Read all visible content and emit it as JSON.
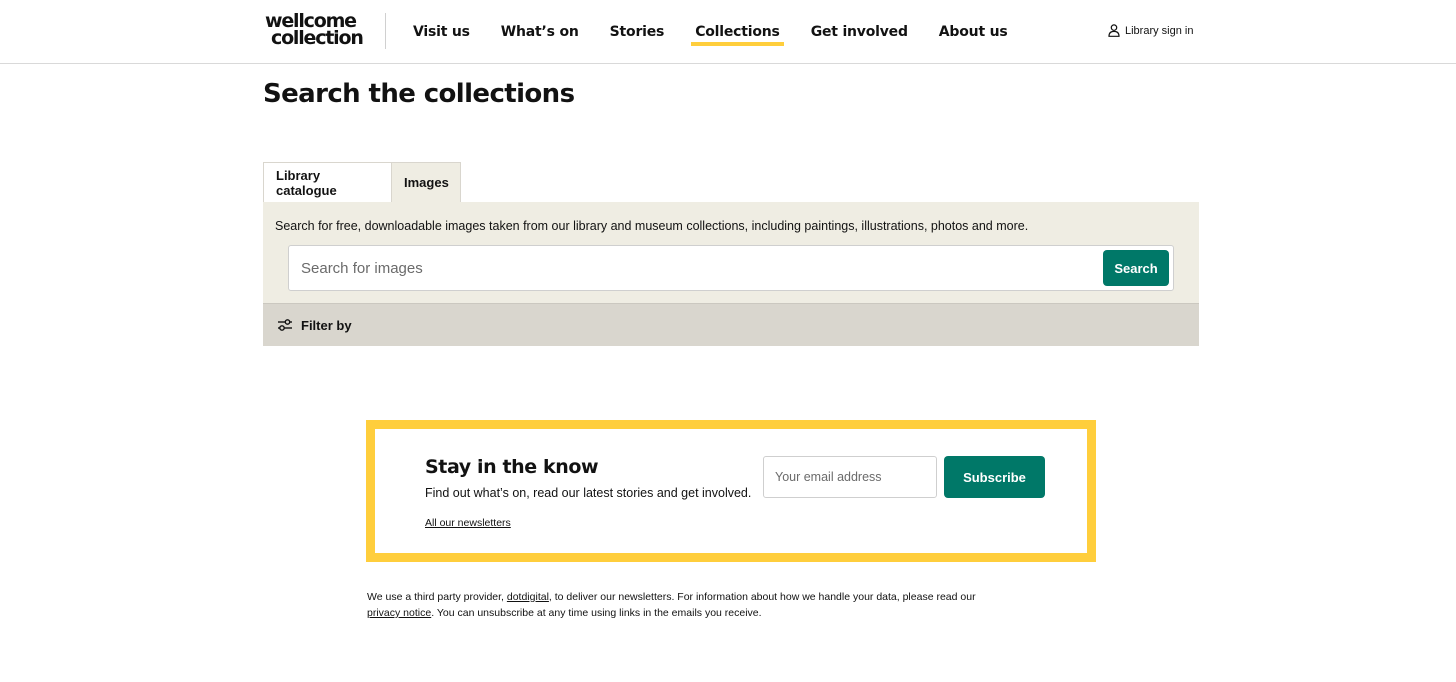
{
  "header": {
    "logo": {
      "line1": "wellcome",
      "line2": "collection"
    },
    "nav": [
      {
        "label": "Visit us",
        "active": false
      },
      {
        "label": "What’s on",
        "active": false
      },
      {
        "label": "Stories",
        "active": false
      },
      {
        "label": "Collections",
        "active": true
      },
      {
        "label": "Get involved",
        "active": false
      },
      {
        "label": "About us",
        "active": false
      }
    ],
    "signin_label": "Library sign in",
    "signin_icon": "user-icon"
  },
  "page": {
    "title": "Search the collections"
  },
  "tabs": [
    {
      "label": "Library catalogue",
      "selected": false
    },
    {
      "label": "Images",
      "selected": true
    }
  ],
  "search": {
    "description": "Search for free, downloadable images taken from our library and museum collections, including paintings, illustrations, photos and more.",
    "placeholder": "Search for images",
    "value": "",
    "button_label": "Search"
  },
  "filter": {
    "label": "Filter by",
    "icon": "sliders-icon"
  },
  "newsletter": {
    "title": "Stay in the know",
    "description": "Find out what’s on, read our latest stories and get involved.",
    "link_label": "All our newsletters",
    "email_placeholder": "Your email address",
    "button_label": "Subscribe"
  },
  "note": {
    "part1": "We use a third party provider, ",
    "link1": "dotdigital",
    "part2": ", to deliver our newsletters. For information about how we handle your data, please read our ",
    "link2": "privacy notice",
    "part3": ". You can unsubscribe at any time using links in the emails you receive."
  },
  "colors": {
    "accent_yellow": "#ffce3c",
    "button_green": "#007868",
    "panel_bg": "#efede3",
    "filter_bg": "#d9d6ce"
  }
}
